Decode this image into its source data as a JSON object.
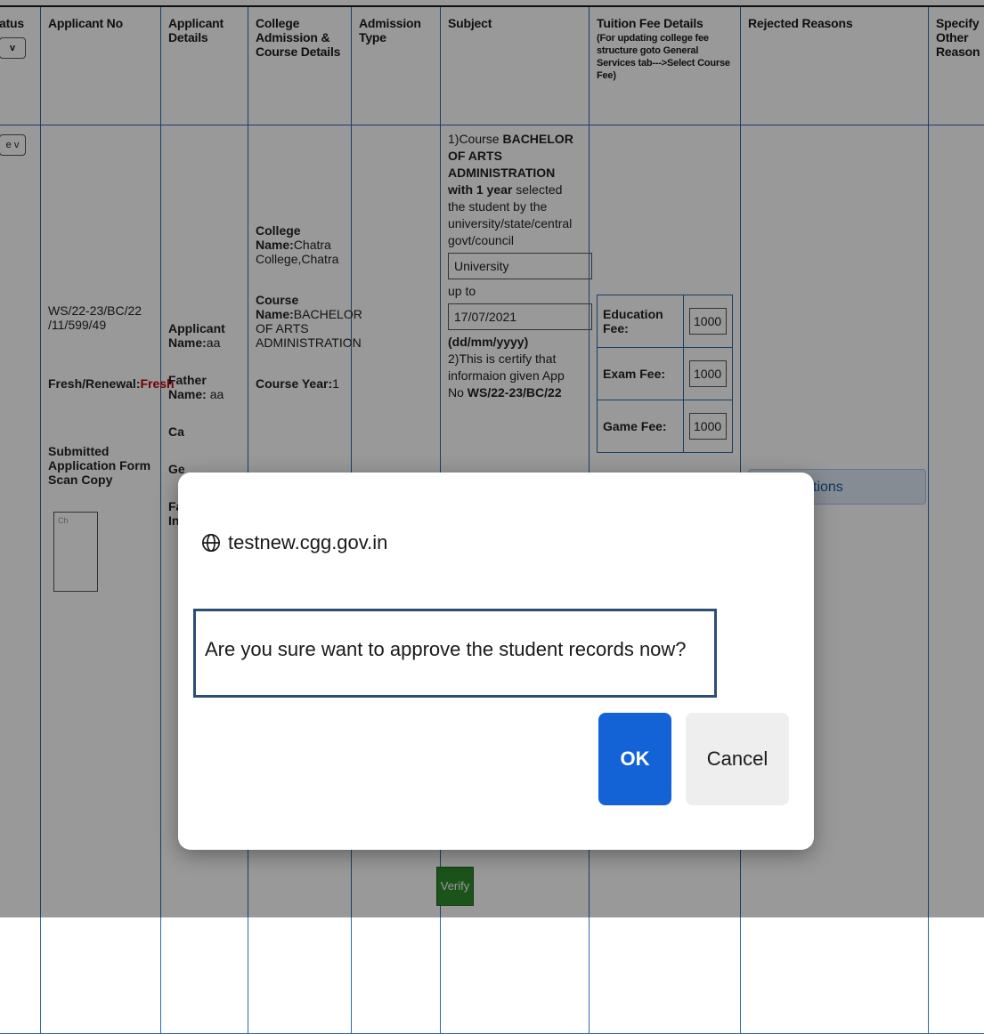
{
  "table": {
    "headers": {
      "status": "atus",
      "applicant_no": "Applicant No",
      "applicant_details": "Applicant Details",
      "college": "College Admission & Course Details",
      "admission_type": "Admission Type",
      "subject": "Subject",
      "tuition": "Tuition Fee Details",
      "tuition_note": "(For updating college fee structure goto General Services tab--->Select Course Fee)",
      "rejected": "Rejected Reasons",
      "other": "Specify Other Reason"
    },
    "row": {
      "status_select_top": "v",
      "status_select": "e v",
      "applicant_no": "WS/22-23/BC/22 /11/599/49",
      "fresh_label": "Fresh/Renewal:",
      "fresh_value": "Fresh",
      "submitted_label": "Submitted Application Form Scan Copy",
      "scan_placeholder": "Ch",
      "applicant_name_label": "Applicant Name:",
      "applicant_name": "aa",
      "father_label": "Father Name:",
      "father_name": "aa",
      "cat_label": "Ca",
      "ge_label": "Ge",
      "fa_label": "Fa",
      "inc_label": "Inc",
      "college_label": "College Name:",
      "college_name": "Chatra College,Chatra",
      "course_label": "Course Name:",
      "course_name": "BACHELOR OF ARTS ADMINISTRATION",
      "course_year_label": "Course Year:",
      "course_year": "1",
      "subject": {
        "p1_a": "1)Course ",
        "p1_course": "BACHELOR OF ARTS ADMINISTRATION with 1 year",
        "p1_b": " selected the student by the university/state/central govt/council",
        "authority": "University",
        "upto": "up to",
        "date": "17/07/2021",
        "date_fmt": "(dd/mm/yyyy)",
        "p2": "2)This is certify that informaion given App No",
        "p2_appno": "WS/22-23/BC/22"
      },
      "fees": [
        {
          "label": "Education Fee:",
          "value": "1000"
        },
        {
          "label": "Exam Fee:",
          "value": "1000"
        },
        {
          "label": "Game Fee:",
          "value": "1000"
        }
      ],
      "rejected_placeholder": "tions"
    }
  },
  "verify_label": "Verify",
  "dialog": {
    "origin": "testnew.cgg.gov.in",
    "message": "Are you sure want to approve the student records now?",
    "ok": "OK",
    "cancel": "Cancel"
  }
}
